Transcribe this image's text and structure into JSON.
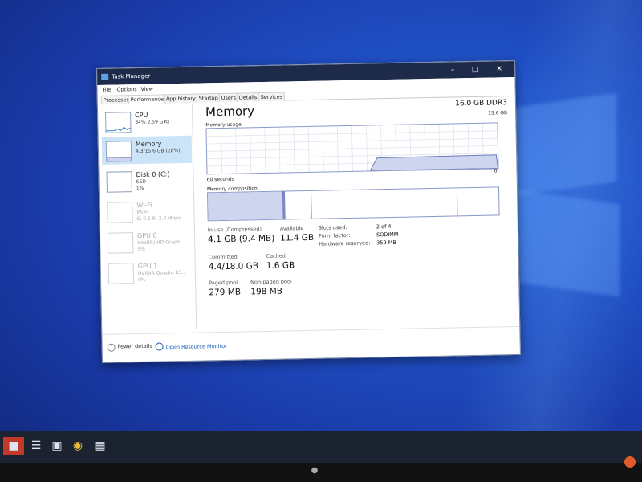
{
  "window": {
    "title": "Task Manager"
  },
  "menu": [
    "File",
    "Options",
    "View"
  ],
  "tabs": [
    "Processes",
    "Performance",
    "App history",
    "Startup",
    "Users",
    "Details",
    "Services"
  ],
  "active_tab": "Performance",
  "sidebar": [
    {
      "name": "CPU",
      "line1": "34%  2.59 GHz",
      "line2": "",
      "active": false,
      "dim": false
    },
    {
      "name": "Memory",
      "line1": "4.3/15.6 GB (28%)",
      "line2": "",
      "active": true,
      "dim": false
    },
    {
      "name": "Disk 0 (C:)",
      "line1": "SSD",
      "line2": "1%",
      "active": false,
      "dim": false
    },
    {
      "name": "Wi-Fi",
      "line1": "Wi-Fi",
      "line2": "S: 0.1  R: 2.3 Mbps",
      "active": false,
      "dim": true
    },
    {
      "name": "GPU 0",
      "line1": "Intel(R) HD Graphi...",
      "line2": "5%",
      "active": false,
      "dim": true
    },
    {
      "name": "GPU 1",
      "line1": "NVIDIA Quadro K3...",
      "line2": "0%",
      "active": false,
      "dim": true
    }
  ],
  "memory": {
    "title": "Memory",
    "total": "16.0 GB DDR3",
    "max": "15.6 GB",
    "usage_label": "Memory usage",
    "time_label": "60 seconds",
    "zero_label": "0",
    "composition_label": "Memory composition",
    "usage_fraction": 0.28,
    "stats": {
      "in_use_label": "In use (Compressed)",
      "in_use_value": "4.1 GB (9.4 MB)",
      "available_label": "Available",
      "available_value": "11.4 GB",
      "committed_label": "Committed",
      "committed_value": "4.4/18.0 GB",
      "cached_label": "Cached",
      "cached_value": "1.6 GB",
      "paged_label": "Paged pool",
      "paged_value": "279 MB",
      "nonpaged_label": "Non-paged pool",
      "nonpaged_value": "198 MB"
    },
    "details": {
      "slots_label": "Slots used:",
      "slots_value": "2 of 4",
      "form_label": "Form factor:",
      "form_value": "SODIMM",
      "hwres_label": "Hardware reserved:",
      "hwres_value": "359 MB"
    }
  },
  "footer": {
    "fewer_details": "Fewer details",
    "resource_monitor": "Open Resource Monitor"
  },
  "colors": {
    "titlebar": "#1e2a49",
    "selected": "#cce4f7",
    "graph_line": "#6a78b8",
    "graph_fill": "#cdd5ef",
    "link": "#1a5fb4"
  }
}
